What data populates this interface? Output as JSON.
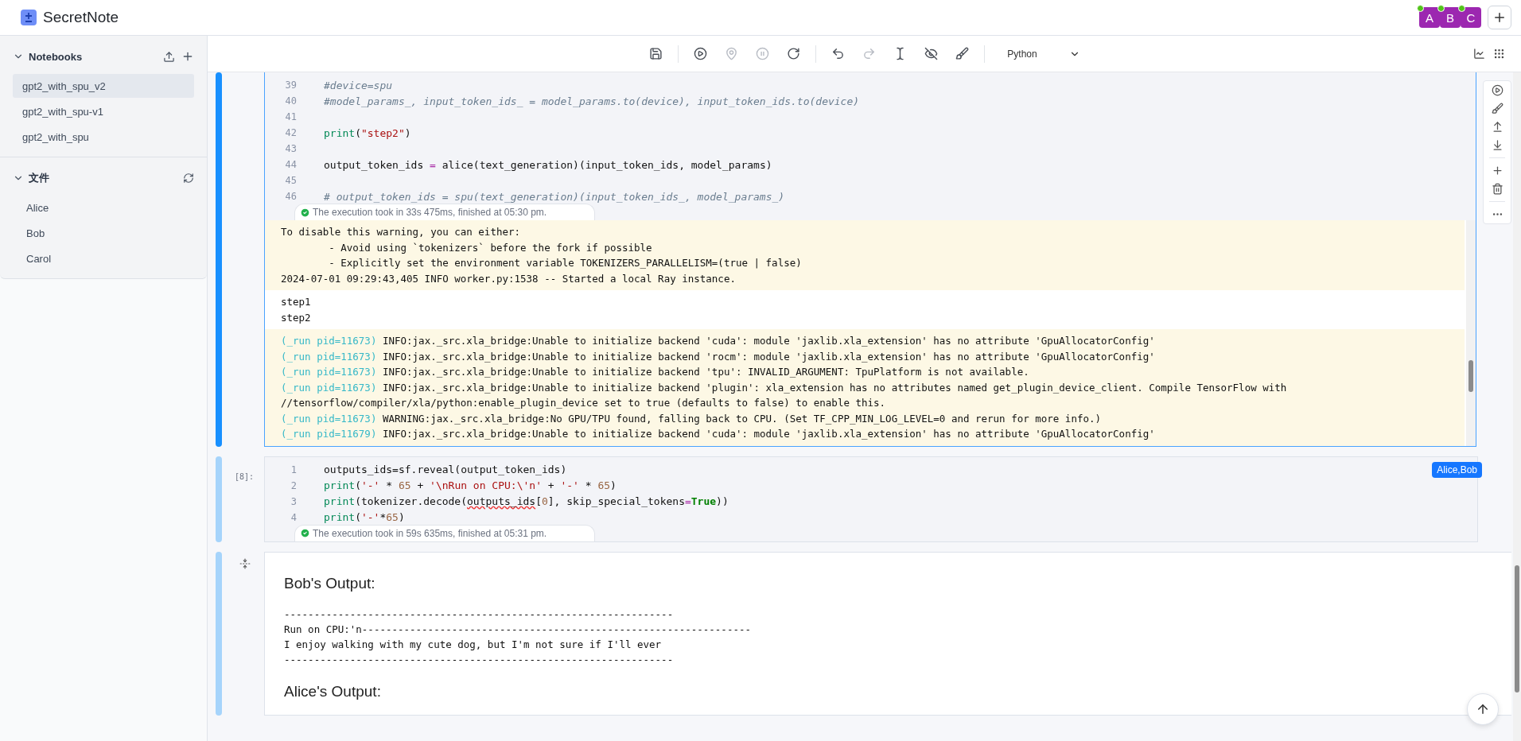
{
  "app": {
    "title": "SecretNote"
  },
  "collaborators": [
    {
      "letter": "A",
      "online": true
    },
    {
      "letter": "B",
      "online": true
    },
    {
      "letter": "C",
      "online": true
    }
  ],
  "sidebar": {
    "notebooks": {
      "title": "Notebooks",
      "expanded": true,
      "items": [
        {
          "label": "gpt2_with_spu_v2",
          "selected": true
        },
        {
          "label": "gpt2_with_spu-v1",
          "selected": false
        },
        {
          "label": "gpt2_with_spu",
          "selected": false
        }
      ]
    },
    "files": {
      "title": "文件",
      "expanded": true,
      "items": [
        {
          "label": "Alice"
        },
        {
          "label": "Bob"
        },
        {
          "label": "Carol"
        }
      ]
    }
  },
  "toolbar": {
    "groups": [
      [
        {
          "kind": "save",
          "disabled": false
        }
      ],
      [
        {
          "kind": "run",
          "disabled": false
        },
        {
          "kind": "locate",
          "disabled": true
        },
        {
          "kind": "pause",
          "disabled": true
        },
        {
          "kind": "restart",
          "disabled": false
        }
      ],
      [
        {
          "kind": "undo",
          "disabled": false
        },
        {
          "kind": "redo",
          "disabled": true
        },
        {
          "kind": "cursor",
          "disabled": false
        },
        {
          "kind": "hide",
          "disabled": false
        },
        {
          "kind": "clean",
          "disabled": false
        }
      ]
    ],
    "language": "Python"
  },
  "cells": [
    {
      "kind": "code",
      "selected": true,
      "lines": [
        {
          "n": "39",
          "tokens": [
            {
              "text": "#device=spu",
              "kind": "comment"
            }
          ]
        },
        {
          "n": "40",
          "tokens": [
            {
              "text": "#model_params_, input_token_ids_ = model_params.to(device), input_token_ids.to(device)",
              "kind": "comment"
            }
          ]
        },
        {
          "n": "41"
        },
        {
          "n": "42",
          "tokens": [
            {
              "text": "print",
              "kind": "builtin"
            },
            {
              "text": "(",
              "kind": "plain"
            },
            {
              "text": "\"step2\"",
              "kind": "string"
            },
            {
              "text": ")",
              "kind": "plain"
            }
          ]
        },
        {
          "n": "43"
        },
        {
          "n": "44",
          "tokens": [
            {
              "text": "output_token_ids ",
              "kind": "plain"
            },
            {
              "text": "=",
              "kind": "op"
            },
            {
              "text": " alice(text_generation)(input_token_ids, model_params)",
              "kind": "plain"
            }
          ]
        },
        {
          "n": "45"
        },
        {
          "n": "46",
          "tokens": [
            {
              "text": "# output_token_ids = spu(text_generation)(input_token_ids_, model_params_)",
              "kind": "comment"
            }
          ]
        }
      ],
      "status": "The execution took in 33s 475ms, finished at 05:30 pm.",
      "outputs": [
        {
          "kind": "stderr",
          "lines": [
            {
              "text": "To disable this warning, you can either:"
            },
            {
              "text": "        - Avoid using `tokenizers` before the fork if possible"
            },
            {
              "text": "        - Explicitly set the environment variable TOKENIZERS_PARALLELISM=(true | false)"
            },
            {
              "text": "2024-07-01 09:29:43,405 INFO worker.py:1538 -- Started a local Ray instance."
            }
          ]
        },
        {
          "kind": "stdout",
          "lines": [
            {
              "text": "step1"
            },
            {
              "text": "step2"
            }
          ]
        },
        {
          "kind": "stderr",
          "lines": [
            {
              "prefix": "(_run pid=11673)",
              "text": " INFO:jax._src.xla_bridge:Unable to initialize backend 'cuda': module 'jaxlib.xla_extension' has no attribute 'GpuAllocatorConfig'"
            },
            {
              "prefix": "(_run pid=11673)",
              "text": " INFO:jax._src.xla_bridge:Unable to initialize backend 'rocm': module 'jaxlib.xla_extension' has no attribute 'GpuAllocatorConfig'"
            },
            {
              "prefix": "(_run pid=11673)",
              "text": " INFO:jax._src.xla_bridge:Unable to initialize backend 'tpu': INVALID_ARGUMENT: TpuPlatform is not available."
            },
            {
              "prefix": "(_run pid=11673)",
              "text": " INFO:jax._src.xla_bridge:Unable to initialize backend 'plugin': xla_extension has no attributes named get_plugin_device_client. Compile TensorFlow with"
            },
            {
              "text": "//tensorflow/compiler/xla/python:enable_plugin_device set to true (defaults to false) to enable this."
            },
            {
              "prefix": "(_run pid=11673)",
              "text": " WARNING:jax._src.xla_bridge:No GPU/TPU found, falling back to CPU. (Set TF_CPP_MIN_LOG_LEVEL=0 and rerun for more info.)"
            },
            {
              "prefix": "(_run pid=11679)",
              "text": " INFO:jax._src.xla_bridge:Unable to initialize backend 'cuda': module 'jaxlib.xla_extension' has no attribute 'GpuAllocatorConfig'"
            }
          ]
        }
      ]
    },
    {
      "kind": "code",
      "selected": false,
      "count": "[8]:",
      "badge": "Alice,Bob",
      "lines": [
        {
          "n": "1",
          "tokens": [
            {
              "text": "outputs_ids=sf.reveal(output_token_ids)",
              "kind": "plain"
            }
          ]
        },
        {
          "n": "2",
          "tokens": [
            {
              "text": "print",
              "kind": "builtin"
            },
            {
              "text": "(",
              "kind": "plain"
            },
            {
              "text": "'-'",
              "kind": "string"
            },
            {
              "text": " * ",
              "kind": "plain"
            },
            {
              "text": "65",
              "kind": "number"
            },
            {
              "text": " + ",
              "kind": "plain"
            },
            {
              "text": "'\\nRun on CPU:\\'n'",
              "kind": "string"
            },
            {
              "text": " + ",
              "kind": "plain"
            },
            {
              "text": "'-'",
              "kind": "string"
            },
            {
              "text": " * ",
              "kind": "plain"
            },
            {
              "text": "65",
              "kind": "number"
            },
            {
              "text": ")",
              "kind": "plain"
            }
          ]
        },
        {
          "n": "3",
          "tokens": [
            {
              "text": "print",
              "kind": "builtin"
            },
            {
              "text": "(tokenizer.decode(",
              "kind": "plain"
            },
            {
              "text": "outputs_ids",
              "kind": "error"
            },
            {
              "text": "[",
              "kind": "plain"
            },
            {
              "text": "0",
              "kind": "number"
            },
            {
              "text": "], skip_special_tokens",
              "kind": "plain"
            },
            {
              "text": "=",
              "kind": "op"
            },
            {
              "text": "True",
              "kind": "keyword"
            },
            {
              "text": "))",
              "kind": "plain"
            }
          ]
        },
        {
          "n": "4",
          "tokens": [
            {
              "text": "print",
              "kind": "builtin"
            },
            {
              "text": "(",
              "kind": "plain"
            },
            {
              "text": "'-'",
              "kind": "string"
            },
            {
              "text": "*",
              "kind": "plain"
            },
            {
              "text": "65",
              "kind": "number"
            },
            {
              "text": ")",
              "kind": "plain"
            }
          ]
        }
      ],
      "status": "The execution took in 59s 635ms, finished at 05:31 pm."
    },
    {
      "kind": "output",
      "selected": false,
      "blocks": [
        {
          "kind": "heading",
          "text": "Bob's Output:"
        },
        {
          "kind": "pre",
          "lines": [
            "-----------------------------------------------------------------",
            "Run on CPU:'n-----------------------------------------------------------------",
            "I enjoy walking with my cute dog, but I'm not sure if I'll ever",
            "-----------------------------------------------------------------"
          ]
        },
        {
          "kind": "heading",
          "text": "Alice's Output:"
        }
      ]
    }
  ]
}
